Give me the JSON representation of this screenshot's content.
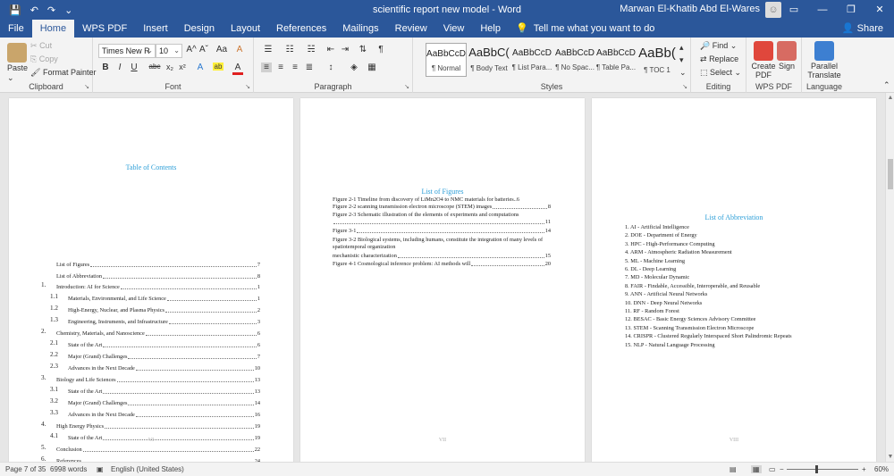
{
  "window": {
    "title": "scientific report new model  -  Word",
    "user": "Marwan El-Khatib Abd El-Wares",
    "qat": [
      "💾",
      "↶",
      "↷",
      "⌄"
    ],
    "controls": [
      "▭",
      "—",
      "❐",
      "✕"
    ]
  },
  "tabs": [
    "File",
    "Home",
    "WPS PDF",
    "Insert",
    "Design",
    "Layout",
    "References",
    "Mailings",
    "Review",
    "View",
    "Help"
  ],
  "active_tab": "Home",
  "tell_me": "Tell me what you want to do",
  "share": "Share",
  "ribbon": {
    "clipboard": {
      "label": "Clipboard",
      "paste": "Paste",
      "cut": "Cut",
      "copy": "Copy",
      "format_painter": "Format Painter"
    },
    "font": {
      "label": "Font",
      "name": "Times New R",
      "size": "10",
      "grow": "A^",
      "shrink": "Aˇ",
      "case": "Aa",
      "clear": "A",
      "bold": "B",
      "italic": "I",
      "underline": "U",
      "strike": "abc",
      "sub": "x₂",
      "sup": "x²",
      "effects": "A",
      "highlight": "ab",
      "color": "A"
    },
    "paragraph": {
      "label": "Paragraph"
    },
    "styles": {
      "label": "Styles",
      "items": [
        {
          "sample": "AaBbCcD",
          "name": "¶ Normal"
        },
        {
          "sample": "AaBbC(",
          "name": "¶ Body Text"
        },
        {
          "sample": "AaBbCcD",
          "name": "¶ List Para..."
        },
        {
          "sample": "AaBbCcD",
          "name": "¶ No Spac..."
        },
        {
          "sample": "AaBbCcD",
          "name": "¶ Table Pa..."
        },
        {
          "sample": "AaBb(",
          "name": "¶ TOC 1"
        }
      ]
    },
    "editing": {
      "label": "Editing",
      "find": "Find",
      "replace": "Replace",
      "select": "Select"
    },
    "wps_pdf": {
      "label": "WPS PDF",
      "create": "Create PDF",
      "sign": "Sign"
    },
    "language": {
      "label": "Language",
      "translate": "Parallel Translate"
    }
  },
  "pages": {
    "toc": {
      "title": "Table of Contents",
      "page_number": "VI",
      "entries": [
        {
          "num": "",
          "text": "List of Figures",
          "page": "7"
        },
        {
          "num": "",
          "text": "List of Abbreviation",
          "page": "8"
        },
        {
          "num": "1.",
          "text": "Introduction: AI for Science",
          "page": "1"
        },
        {
          "num": "1.1",
          "text": "Materials, Environmental, and Life Science",
          "page": "1"
        },
        {
          "num": "1.2",
          "text": "High-Energy, Nuclear, and Plasma Physics",
          "page": "2"
        },
        {
          "num": "1.3",
          "text": "Engineering, Instruments, and Infrastructure",
          "page": "3"
        },
        {
          "num": "2.",
          "text": "Chemistry, Materials, and Nanoscience",
          "page": "6"
        },
        {
          "num": "2.1",
          "text": "State of the Art",
          "page": "6"
        },
        {
          "num": "2.2",
          "text": "Major (Grand) Challenges",
          "page": "7"
        },
        {
          "num": "2.3",
          "text": "Advances in the Next Decade",
          "page": "10"
        },
        {
          "num": "3.",
          "text": "Biology and Life Sciences",
          "page": "13"
        },
        {
          "num": "3.1",
          "text": "State of the Art",
          "page": "13"
        },
        {
          "num": "3.2",
          "text": "Major (Grand) Challenges",
          "page": "14"
        },
        {
          "num": "3.3",
          "text": "Advances in the Next Decade",
          "page": "16"
        },
        {
          "num": "4.",
          "text": "High Energy Physics",
          "page": "19"
        },
        {
          "num": "4.1",
          "text": "State of the Art",
          "page": "19"
        },
        {
          "num": "5.",
          "text": "Conclusion",
          "page": "22"
        },
        {
          "num": "6.",
          "text": "References",
          "page": "24"
        }
      ]
    },
    "lof": {
      "title": "List of Figures",
      "page_number": "VII",
      "lines": [
        "Figure 2-1 Timeline from discovery of LiMn2O4 to NMC materials for batteries..6",
        "Figure 2-2 scanning transmission electron microscope (STEM) images",
        "8",
        "Figure 2-3 Schematic illustration of the elements of experiments and computations",
        "11",
        "Figure 3-1",
        "14",
        "Figure 3-2 Biological systems, including humans, constitute the integration of many levels of spatiotemporal organization",
        "mechanistic characterization",
        "15",
        "Figure 4-1 Cosmological inference problem: AI methods will",
        "20"
      ]
    },
    "abbr": {
      "title": "List of Abbreviation",
      "page_number": "VIII",
      "items": [
        "1. AI - Artificial Intelligence",
        "2. DOE - Department of Energy",
        "3. HPC - High-Performance Computing",
        "4. ARM - Atmospheric Radiation Measurement",
        "5. ML - Machine Learning",
        "6. DL - Deep Learning",
        "7. MD - Molecular Dynamic",
        "8. FAIR - Findable, Accessible, Interoperable, and Reusable",
        "9. ANN - Artificial Neural Networks",
        "10. DNN - Deep Neural Networks",
        "11. RF - Random Forest",
        "12. BESAC - Basic Energy Sciences Advisory Committee",
        "13. STEM - Scanning Transmission Electron Microscope",
        "14. CRISPR - Clustered Regularly Interspaced Short Palindromic Repeats",
        "15. NLP - Natural Language Processing"
      ]
    }
  },
  "status": {
    "page": "Page 7 of 35",
    "words": "6998 words",
    "language": "English (United States)",
    "zoom": "60%",
    "minus": "−",
    "plus": "+"
  },
  "colors": {
    "brand": "#2b579a",
    "heading": "#2e9fd8"
  }
}
